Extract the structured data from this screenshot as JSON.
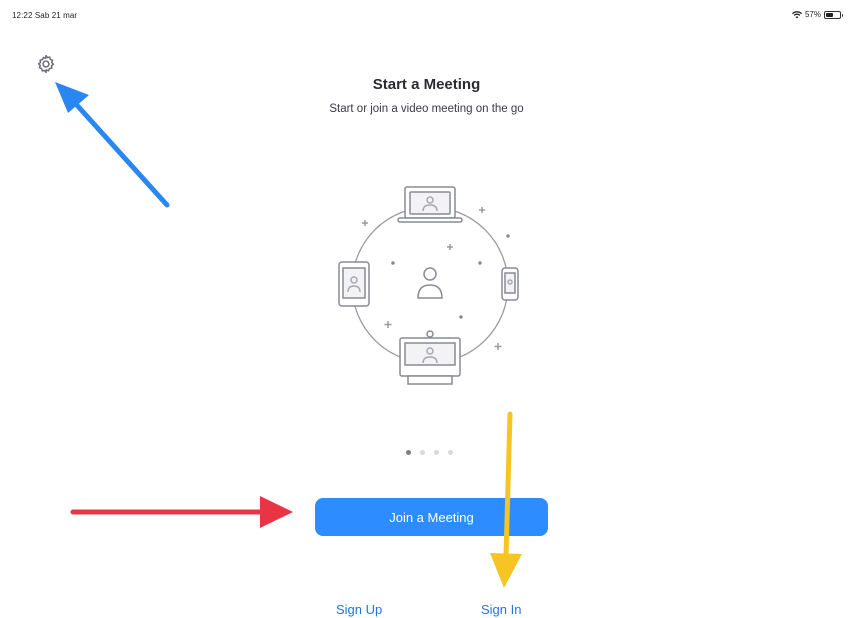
{
  "status_bar": {
    "time_date": "12:22  Sab 21 mar",
    "battery_percent": "57%",
    "battery_level": 0.57
  },
  "header": {
    "settings_icon": "gear-icon"
  },
  "main": {
    "title": "Start a Meeting",
    "subtitle": "Start or join a video meeting on the go",
    "illustration_icon": "devices-network-icon",
    "pager": {
      "count": 4,
      "active_index": 0
    },
    "join_button_label": "Join a Meeting",
    "sign_up_label": "Sign Up",
    "sign_in_label": "Sign In"
  },
  "colors": {
    "primary_blue": "#2d8cff",
    "link_blue": "#1f74ea",
    "annotation_blue": "#2a86f0",
    "annotation_red": "#e83545",
    "annotation_yellow": "#f6c423"
  }
}
